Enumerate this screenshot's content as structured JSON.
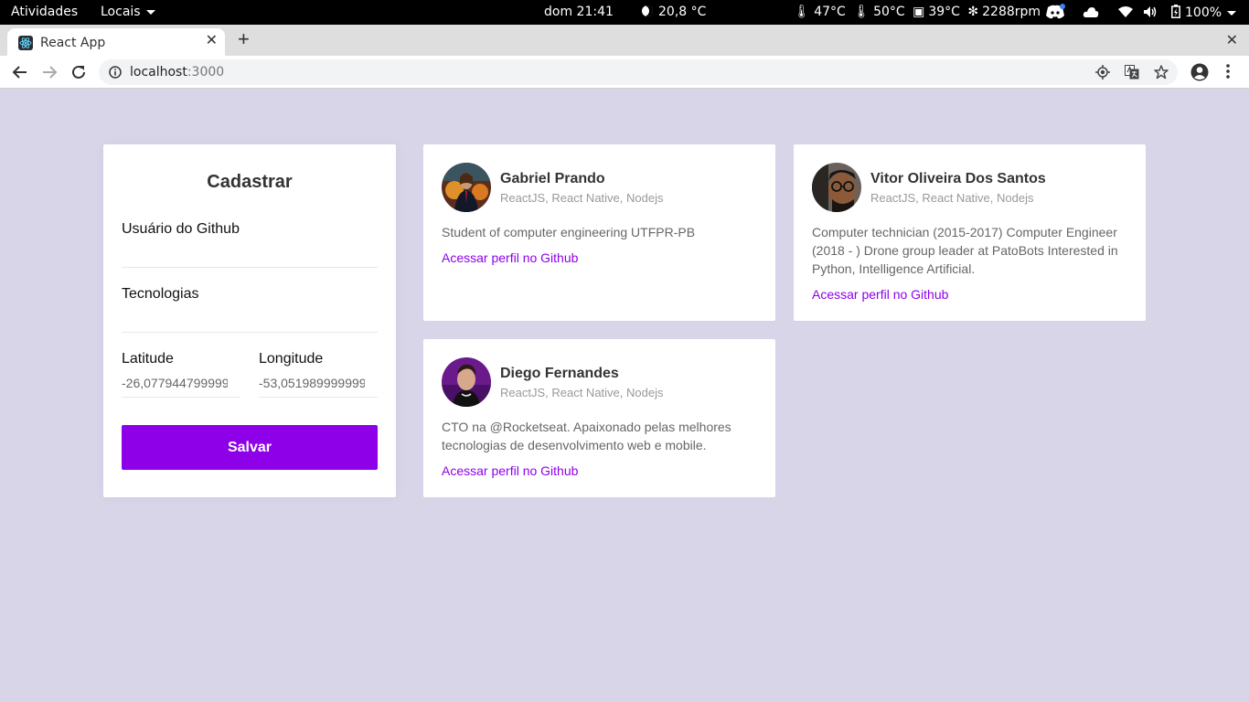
{
  "system_bar": {
    "activities": "Atividades",
    "places": "Locais",
    "clock": "dom 21:41",
    "weather": "20,8 °C",
    "sensors": [
      "47°C",
      "50°C",
      "39°C",
      "2288rpm"
    ],
    "battery": "100%"
  },
  "browser": {
    "tab_title": "React App",
    "url_host": "localhost",
    "url_port": ":3000"
  },
  "form": {
    "title": "Cadastrar",
    "github_user_label": "Usuário do Github",
    "github_user_value": "",
    "techs_label": "Tecnologias",
    "techs_value": "",
    "latitude_label": "Latitude",
    "latitude_value": "-26,077944799999",
    "longitude_label": "Longitude",
    "longitude_value": "-53,051989999999",
    "save_label": "Salvar"
  },
  "devs": [
    {
      "name": "Gabriel Prando",
      "techs": "ReactJS, React Native, Nodejs",
      "bio": "Student of computer engineering UTFPR-PB",
      "link": "Acessar perfil no Github"
    },
    {
      "name": "Vitor Oliveira Dos Santos",
      "techs": "ReactJS, React Native, Nodejs",
      "bio": "Computer technician (2015-2017) Computer Engineer (2018 - ) Drone group leader at PatoBots Interested in Python, Intelligence Artificial.",
      "link": "Acessar perfil no Github"
    },
    {
      "name": "Diego Fernandes",
      "techs": "ReactJS, React Native, Nodejs",
      "bio": "CTO na @Rocketseat. Apaixonado pelas melhores tecnologias de desenvolvimento web e mobile.",
      "link": "Acessar perfil no Github"
    }
  ],
  "colors": {
    "background": "#d8d5e8",
    "accent": "#8e00e8",
    "card": "#ffffff"
  },
  "icons": [
    "moon-icon",
    "thermometer-icon",
    "fan-icon",
    "discord-icon",
    "cloud-icon",
    "wifi-icon",
    "volume-icon",
    "battery-icon",
    "react-icon",
    "back-icon",
    "forward-icon",
    "reload-icon",
    "info-icon",
    "location-icon",
    "translate-icon",
    "star-icon",
    "profile-icon",
    "menu-icon"
  ]
}
